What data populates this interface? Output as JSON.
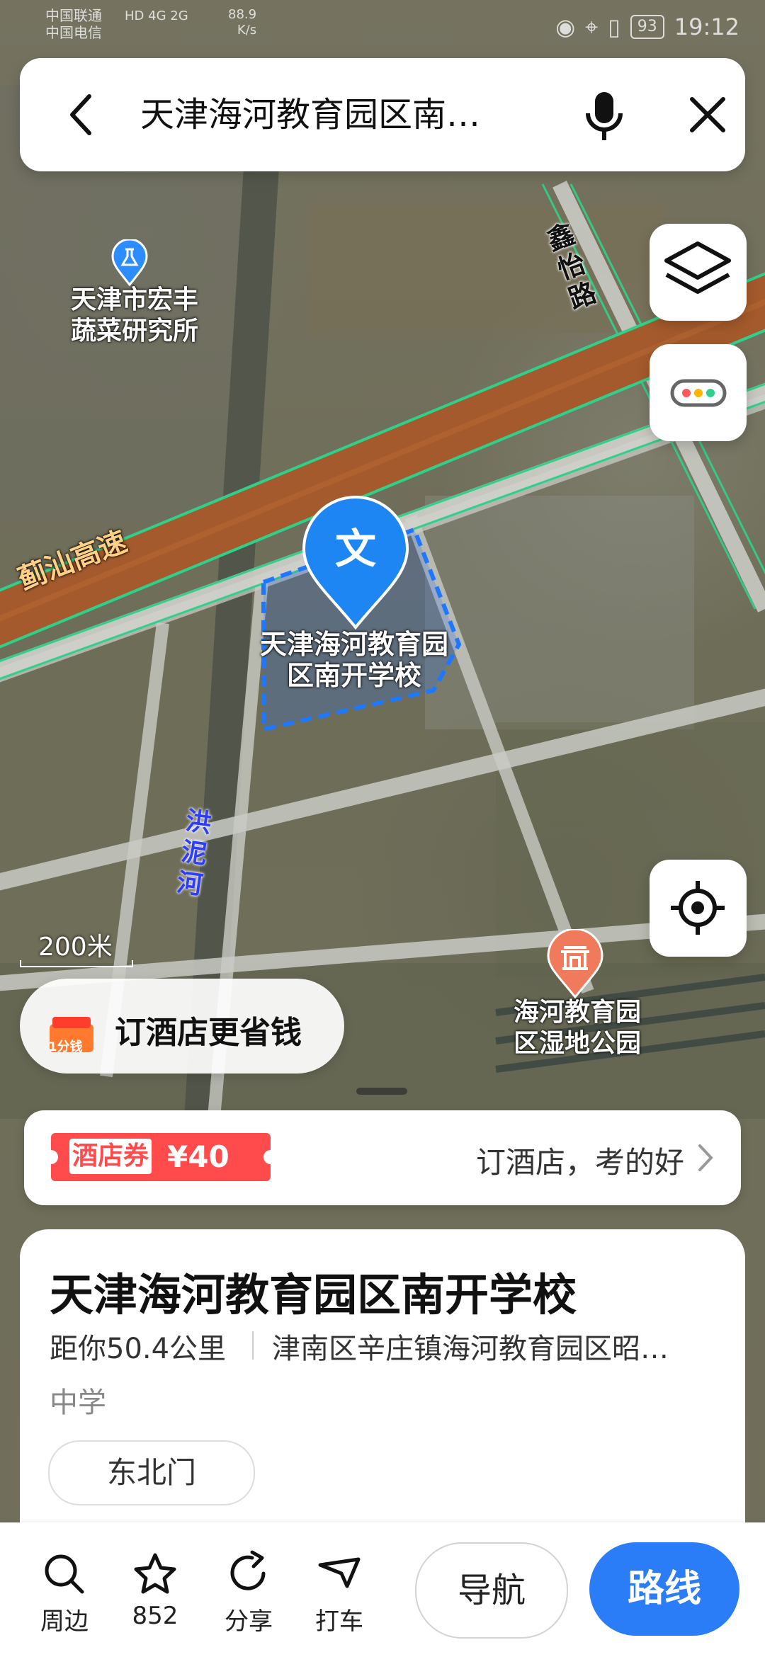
{
  "status_bar": {
    "carrier1": "中国联通",
    "carrier2": "中国电信",
    "network": "HD 4G 2G",
    "speed": "88.9",
    "speed_unit": "K/s",
    "battery": "93",
    "time": "19:12"
  },
  "search": {
    "query": "天津海河教育园区南…",
    "icons": {
      "back": "chevron-left-icon",
      "mic": "mic-icon",
      "close": "close-icon"
    }
  },
  "map": {
    "labels": {
      "poi_research": "天津市宏丰\n蔬菜研究所",
      "selected_poi": "天津海河教育园\n区南开学校",
      "park_poi": "海河教育园\n区湿地公园",
      "road_xinyi": "鑫\n怡\n路",
      "expressway": "蓟汕高速",
      "river": "洪\n泥\n河"
    },
    "marker_glyph": "文",
    "scale_text": "200米",
    "colors": {
      "expressway": "#a45a2c",
      "road_edge": "#2fd18a",
      "selection": "#1e78ff"
    }
  },
  "promo": {
    "text": "订酒店更省钱",
    "gift_text": "1分钱"
  },
  "coupon": {
    "tag_label": "酒店券",
    "amount": "¥40",
    "cta": "订酒店，考的好"
  },
  "place": {
    "title": "天津海河教育园区南开学校",
    "distance": "距你50.4公里",
    "address": "津南区辛庄镇海河教育园区昭…",
    "category": "中学",
    "chip": "东北门"
  },
  "bottom_bar": {
    "nearby": "周边",
    "favorites": "852",
    "share": "分享",
    "taxi": "打车",
    "navigate": "导航",
    "route": "路线"
  }
}
